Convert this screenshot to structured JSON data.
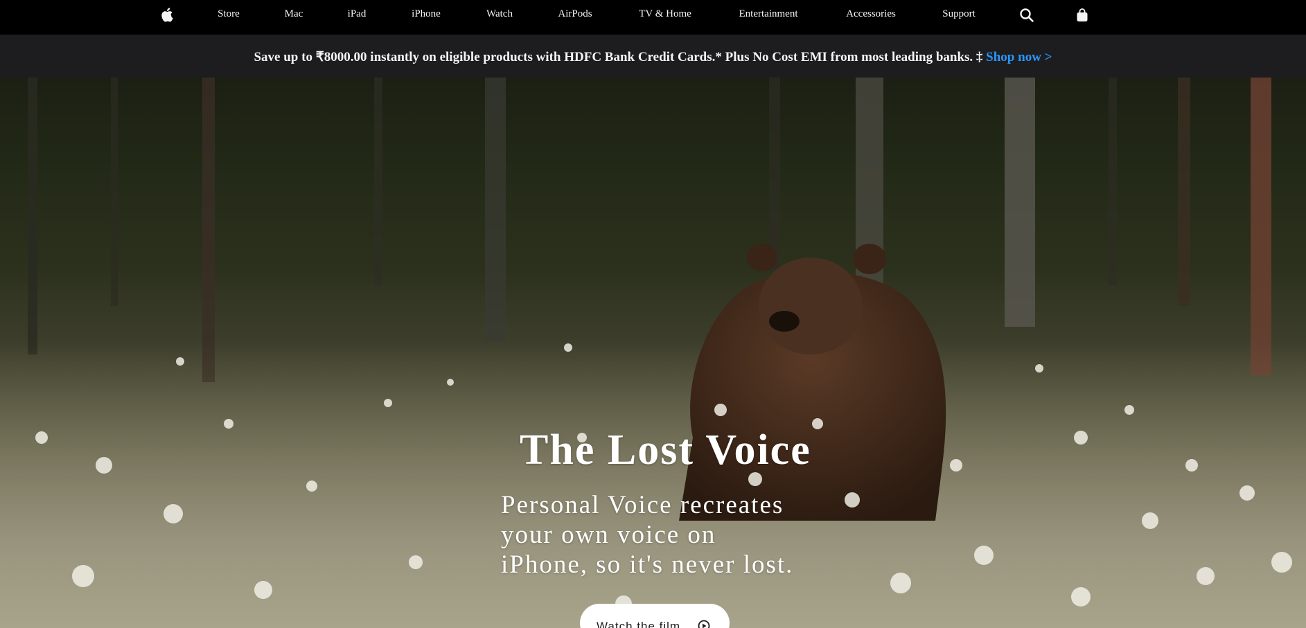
{
  "nav": {
    "apple_logo_icon": "apple-logo-icon",
    "items": [
      {
        "label": "Store"
      },
      {
        "label": "Mac"
      },
      {
        "label": "iPad"
      },
      {
        "label": "iPhone"
      },
      {
        "label": "Watch"
      },
      {
        "label": "AirPods"
      },
      {
        "label": "TV & Home"
      },
      {
        "label": "Entertainment"
      },
      {
        "label": "Accessories"
      },
      {
        "label": "Support"
      }
    ],
    "search_icon": "search-icon",
    "bag_icon": "shopping-bag-icon"
  },
  "promo": {
    "text": "Save up to ₹8000.00 instantly on eligible products with HDFC Bank Credit Cards.* Plus No Cost EMI from most leading banks. ‡ ",
    "link_label": "Shop now >",
    "link_color": "#2997ff"
  },
  "hero": {
    "title": "The Lost Voice",
    "subtitle_lines": [
      "Personal Voice recreates",
      "your own voice on",
      "iPhone, so it's never lost."
    ],
    "cta_label": "Watch the film",
    "cta_icon": "play-circle-icon"
  },
  "colors": {
    "nav_background": "#000000",
    "promo_background": "#1d1d1f",
    "text_light": "#f5f5f7",
    "button_background": "#ffffff"
  }
}
